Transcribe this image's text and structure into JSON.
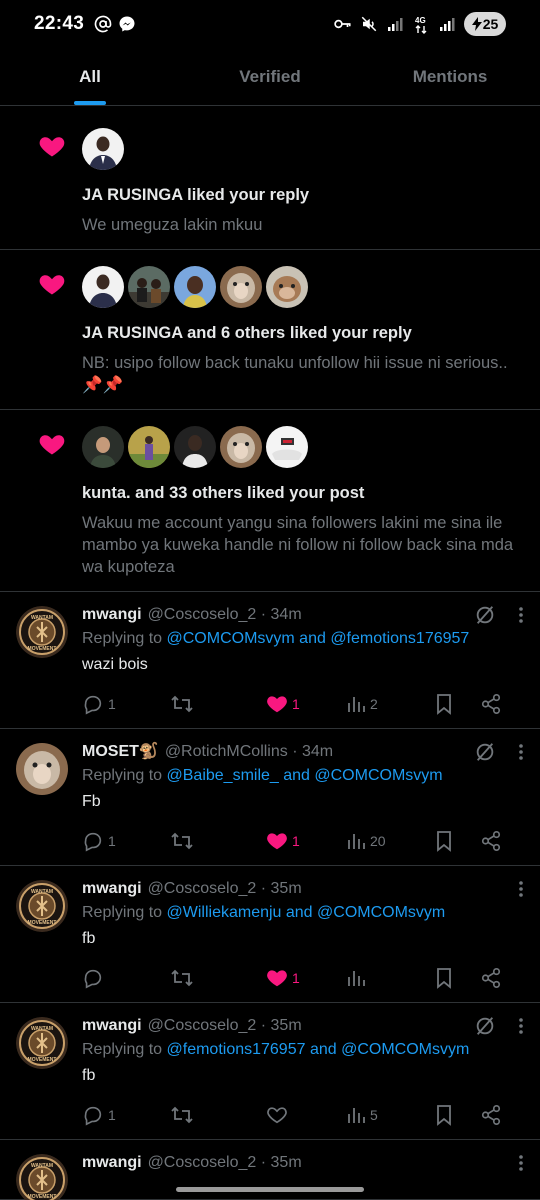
{
  "status_bar": {
    "time": "22:43",
    "battery": "25"
  },
  "tabs": [
    {
      "label": "All",
      "active": true
    },
    {
      "label": "Verified",
      "active": false
    },
    {
      "label": "Mentions",
      "active": false
    }
  ],
  "notifications": [
    {
      "title": "JA RUSINGA liked your reply",
      "body": "We umeguza lakin mkuu",
      "avatar_count": 1
    },
    {
      "title": "JA RUSINGA and 6 others liked your reply",
      "body": "NB: usipo follow back tunaku unfollow hii issue ni serious..📌📌",
      "avatar_count": 5
    },
    {
      "title": "kunta. and 33 others liked your post",
      "body": "Wakuu me account yangu sina followers lakini me sina ile mambo ya kuweka handle ni follow ni follow back sina mda wa kupoteza",
      "avatar_count": 5
    }
  ],
  "tweets": [
    {
      "name": "mwangi",
      "handle": "@Coscoselo_2 · 34m",
      "replying_prefix": "Replying to ",
      "mentions": "@COMCOMsvym and @femotions176957",
      "text": "wazi bois",
      "replies": "1",
      "retweets": "",
      "likes": "1",
      "liked": true,
      "views": "2",
      "show_grok": true
    },
    {
      "name": "MOSET🐒",
      "handle": "@RotichMCollins · 34m",
      "replying_prefix": "Replying to ",
      "mentions": "@Baibe_smile_ and @COMCOMsvym",
      "text": "Fb",
      "replies": "1",
      "retweets": "",
      "likes": "1",
      "liked": true,
      "views": "20",
      "show_grok": true
    },
    {
      "name": "mwangi",
      "handle": "@Coscoselo_2 · 35m",
      "replying_prefix": "Replying to ",
      "mentions": "@Williekamenju and @COMCOMsvym",
      "text": "fb",
      "replies": "",
      "retweets": "",
      "likes": "1",
      "liked": true,
      "views": "",
      "show_grok": false
    },
    {
      "name": "mwangi",
      "handle": "@Coscoselo_2 · 35m",
      "replying_prefix": "Replying to ",
      "mentions": "@femotions176957 and @COMCOMsvym",
      "text": "fb",
      "replies": "1",
      "retweets": "",
      "likes": "",
      "liked": false,
      "views": "5",
      "show_grok": true
    },
    {
      "name": "mwangi",
      "handle": "@Coscoselo_2 · 35m"
    }
  ],
  "colors": {
    "accent": "#1d9bf0",
    "like": "#f91880",
    "muted": "#71767b",
    "divider": "#2f3336"
  }
}
